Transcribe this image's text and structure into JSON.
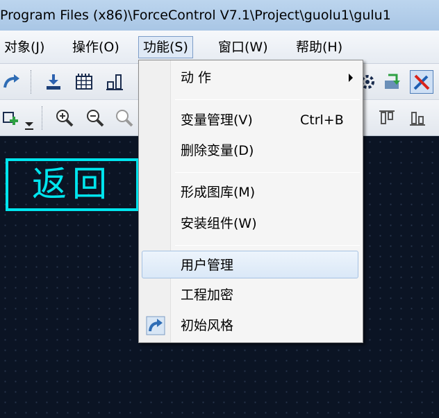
{
  "window": {
    "title": "Program Files (x86)\\ForceControl V7.1\\Project\\guolu1\\gulu1"
  },
  "menubar": {
    "items": [
      {
        "label": "对象(J)"
      },
      {
        "label": "操作(O)"
      },
      {
        "label": "功能(S)"
      },
      {
        "label": "窗口(W)"
      },
      {
        "label": "帮助(H)"
      }
    ]
  },
  "toolbar": {
    "icons": [
      "redo-icon",
      "import-icon",
      "grid-icon",
      "align-icon",
      "settings-icon",
      "export-icon",
      "tools-icon",
      "zoom-in-icon",
      "zoom-out-icon",
      "zoom-reset-icon",
      "align-top-icon",
      "align-bottom-icon"
    ]
  },
  "canvas": {
    "return_label": "返回"
  },
  "dropdown": {
    "items": [
      {
        "label": "动  作",
        "shortcut": "",
        "submenu": true
      },
      {
        "label": "变量管理(V)",
        "shortcut": "Ctrl+B"
      },
      {
        "label": "删除变量(D)",
        "shortcut": ""
      },
      {
        "label": "形成图库(M)",
        "shortcut": ""
      },
      {
        "label": "安装组件(W)",
        "shortcut": ""
      },
      {
        "label": "用户管理",
        "shortcut": "",
        "highlighted": true
      },
      {
        "label": "工程加密",
        "shortcut": ""
      },
      {
        "label": "初始风格",
        "shortcut": "",
        "icon": "redo-icon"
      }
    ]
  },
  "colors": {
    "accent": "#00e5ee",
    "canvas_bg": "#0b1424",
    "highlight_border": "#a5c1e2"
  }
}
